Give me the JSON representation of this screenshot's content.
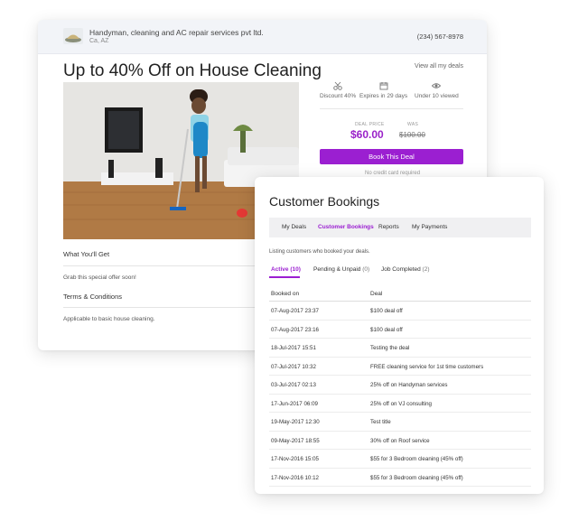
{
  "deal": {
    "business_name": "Handyman, cleaning and AC repair services pvt ltd.",
    "location": "Ca, AZ",
    "phone": "(234) 567-8978",
    "title": "Up to 40% Off on House Cleaning",
    "view_all": "View all my deals",
    "meta": {
      "discount": "Discount 40%",
      "expires": "Expires in 29 days",
      "viewed": "Under 10 viewed"
    },
    "price_label": "DEAL PRICE",
    "was_label": "WAS",
    "price": "$60.00",
    "was_price": "$100.00",
    "book_button": "Book This Deal",
    "no_credit": "No credit card required",
    "what_title": "What You'll Get",
    "what_body": "Grab this special offer soon!",
    "terms_title": "Terms & Conditions",
    "terms_body": "Applicable to basic house cleaning."
  },
  "bookings": {
    "title": "Customer Bookings",
    "nav": [
      "My Deals",
      "Customer Bookings",
      "Reports",
      "My Payments"
    ],
    "subtitle": "Listing customers who booked your deals.",
    "tabs": [
      {
        "label": "Active",
        "count": "(10)"
      },
      {
        "label": "Pending & Unpaid",
        "count": "(0)"
      },
      {
        "label": "Job Completed",
        "count": "(2)"
      }
    ],
    "columns": [
      "Booked on",
      "Deal"
    ],
    "rows": [
      [
        "07-Aug-2017 23:37",
        "$100 deal off"
      ],
      [
        "07-Aug-2017 23:16",
        "$100 deal off"
      ],
      [
        "18-Jul-2017 15:51",
        "Testing the deal"
      ],
      [
        "07-Jul-2017 10:32",
        "FREE cleaning service for 1st time customers"
      ],
      [
        "03-Jul-2017 02:13",
        "25% off on Handyman services"
      ],
      [
        "17-Jun-2017 06:09",
        "25% off on VJ consulting"
      ],
      [
        "19-May-2017 12:30",
        "Test title"
      ],
      [
        "09-May-2017 18:55",
        "30% off on Roof service"
      ],
      [
        "17-Nov-2016 15:05",
        "$55 for 3 Bedroom cleaning (45% off)"
      ],
      [
        "17-Nov-2016 10:12",
        "$55 for 3 Bedroom cleaning (45% off)"
      ]
    ]
  },
  "colors": {
    "accent": "#9b1fd1",
    "header_bg": "#f2f4f8"
  }
}
